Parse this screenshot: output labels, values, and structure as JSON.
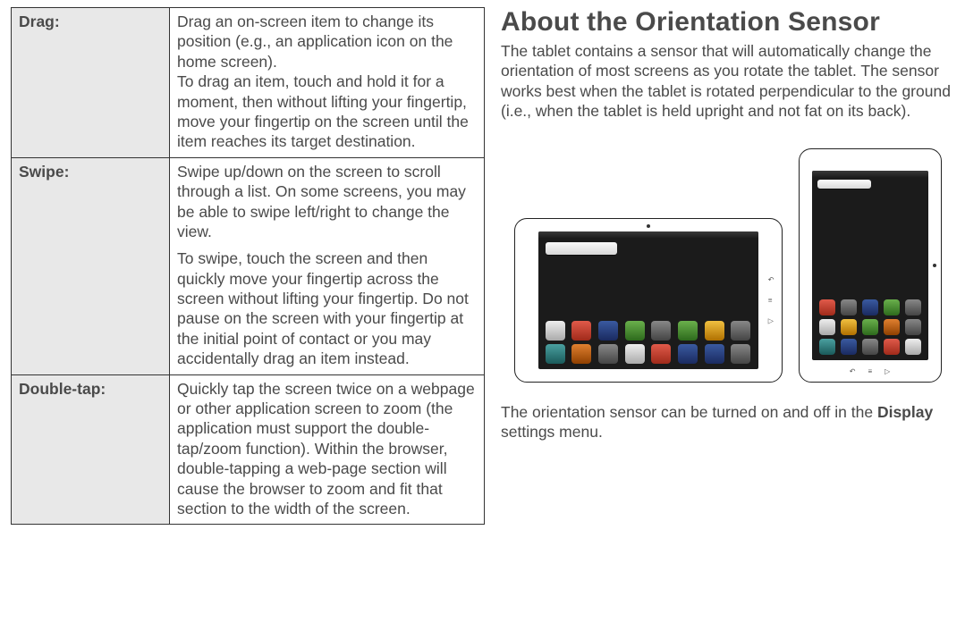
{
  "gestures": [
    {
      "term": "Drag:",
      "paragraphs": [
        "Drag an on-screen item to change its position (e.g., an application icon on the home screen).",
        "To drag an item, touch and hold it for a moment, then without lifting your fingertip, move your fingertip on the screen until the item reaches its target destination."
      ]
    },
    {
      "term": "Swipe:",
      "paragraphs": [
        "Swipe up/down on the screen to scroll through a list. On some screens, you may be able to swipe left/right to change the view.",
        "To swipe, touch the screen and then quickly move your fingertip across the screen without lifting your fingertip. Do not pause on the screen with your fingertip at the initial point of contact or you may accidentally drag an item instead."
      ]
    },
    {
      "term": "Double-tap:",
      "paragraphs": [
        "Quickly tap the screen twice on a webpage or other application screen to zoom (the application must support the double-tap/zoom function). Within the browser, double-tapping a web-page section will cause the browser to zoom and fit that section to the width of the screen."
      ]
    }
  ],
  "section": {
    "title": "About the Orientation Sensor",
    "intro": "The tablet contains a sensor that will automatically change the orientation of most screens as you rotate the tablet. The sensor works best when the tablet is rotated perpendicular to the ground (i.e., when the tablet is held upright and not fat on its back).",
    "footer_pre": "The orientation sensor can be turned on and off in the ",
    "footer_bold": "Display",
    "footer_post": " settings menu."
  },
  "hw_buttons": {
    "back": "↶",
    "menu": "≡",
    "home": "▷"
  }
}
